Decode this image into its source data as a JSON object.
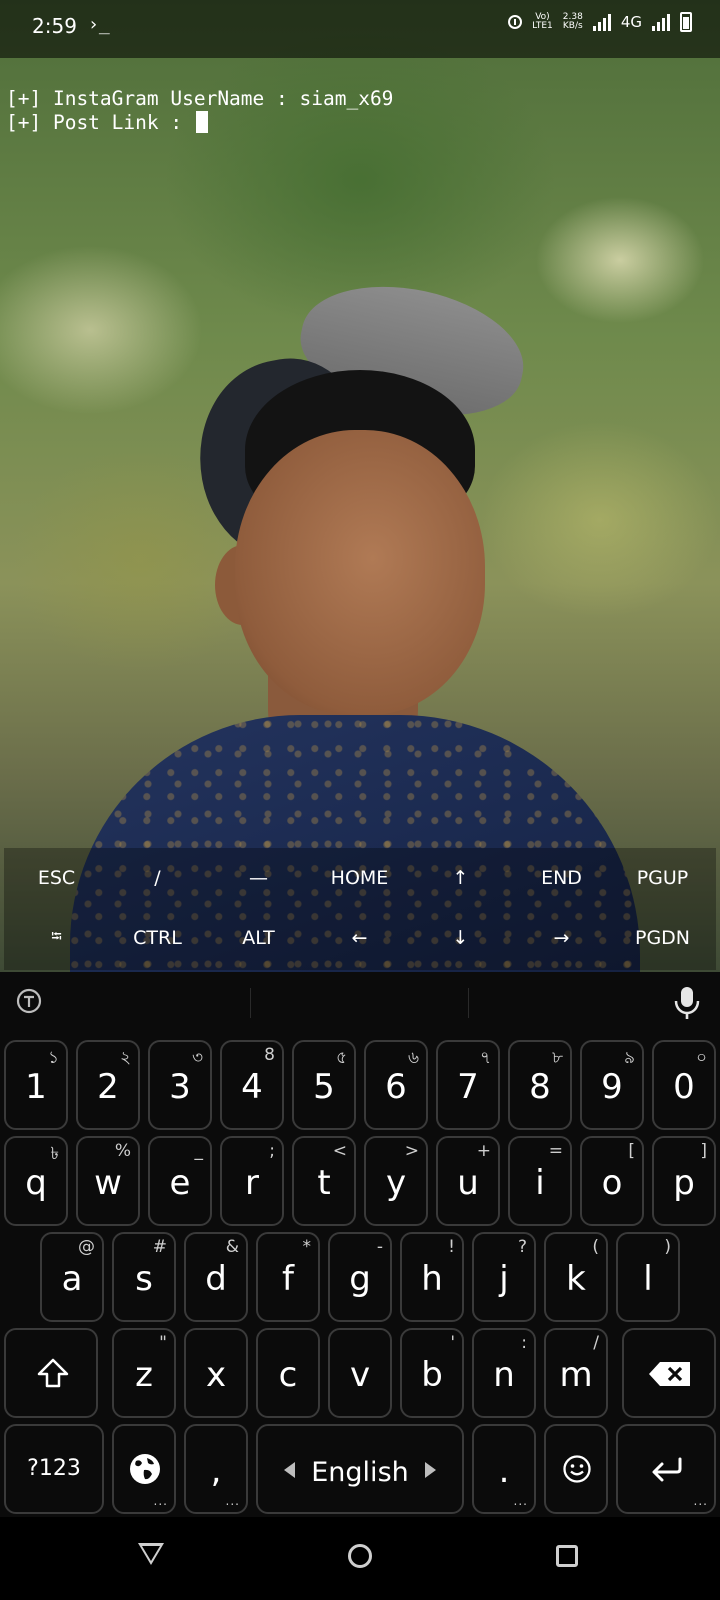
{
  "status_bar": {
    "time": "2:59",
    "terminal_glyph": "›_",
    "volte_top": "Vo)",
    "volte_bottom": "LTE1",
    "speed_value": "2.38",
    "speed_unit": "KB/s",
    "network": "4G"
  },
  "terminal": {
    "line1": "[+] InstaGram UserName : siam_x69",
    "line2": "[+] Post Link : "
  },
  "extra_keys": {
    "row1": [
      "ESC",
      "/",
      "—",
      "HOME",
      "↑",
      "END",
      "PGUP"
    ],
    "row2": [
      "⭾",
      "CTRL",
      "ALT",
      "←",
      "↓",
      "→",
      "PGDN"
    ]
  },
  "keyboard": {
    "numbers": [
      {
        "key": "1",
        "hint": "১"
      },
      {
        "key": "2",
        "hint": "২"
      },
      {
        "key": "3",
        "hint": "৩"
      },
      {
        "key": "4",
        "hint": "8"
      },
      {
        "key": "5",
        "hint": "৫"
      },
      {
        "key": "6",
        "hint": "৬"
      },
      {
        "key": "7",
        "hint": "৭"
      },
      {
        "key": "8",
        "hint": "৮"
      },
      {
        "key": "9",
        "hint": "৯"
      },
      {
        "key": "0",
        "hint": "০"
      }
    ],
    "row_q": [
      {
        "key": "q",
        "hint": "৳"
      },
      {
        "key": "w",
        "hint": "%"
      },
      {
        "key": "e",
        "hint": "_"
      },
      {
        "key": "r",
        "hint": ";"
      },
      {
        "key": "t",
        "hint": "<"
      },
      {
        "key": "y",
        "hint": ">"
      },
      {
        "key": "u",
        "hint": "+"
      },
      {
        "key": "i",
        "hint": "="
      },
      {
        "key": "o",
        "hint": "["
      },
      {
        "key": "p",
        "hint": "]"
      }
    ],
    "row_a": [
      {
        "key": "a",
        "hint": "@"
      },
      {
        "key": "s",
        "hint": "#"
      },
      {
        "key": "d",
        "hint": "&"
      },
      {
        "key": "f",
        "hint": "*"
      },
      {
        "key": "g",
        "hint": "-"
      },
      {
        "key": "h",
        "hint": "!"
      },
      {
        "key": "j",
        "hint": "?"
      },
      {
        "key": "k",
        "hint": "("
      },
      {
        "key": "l",
        "hint": ")"
      }
    ],
    "row_z": [
      {
        "key": "z",
        "hint": "\""
      },
      {
        "key": "x",
        "hint": ""
      },
      {
        "key": "c",
        "hint": ""
      },
      {
        "key": "v",
        "hint": ""
      },
      {
        "key": "b",
        "hint": "'"
      },
      {
        "key": "n",
        "hint": ":"
      },
      {
        "key": "m",
        "hint": "/"
      }
    ],
    "symbols_key": "?123",
    "comma_key": ",",
    "space_label": "English",
    "period_key": ".",
    "more_dots": "..."
  },
  "colors": {
    "keyboard_bg": "#0b0b0b",
    "key_border": "#3a3a3a",
    "text": "#ffffff"
  }
}
